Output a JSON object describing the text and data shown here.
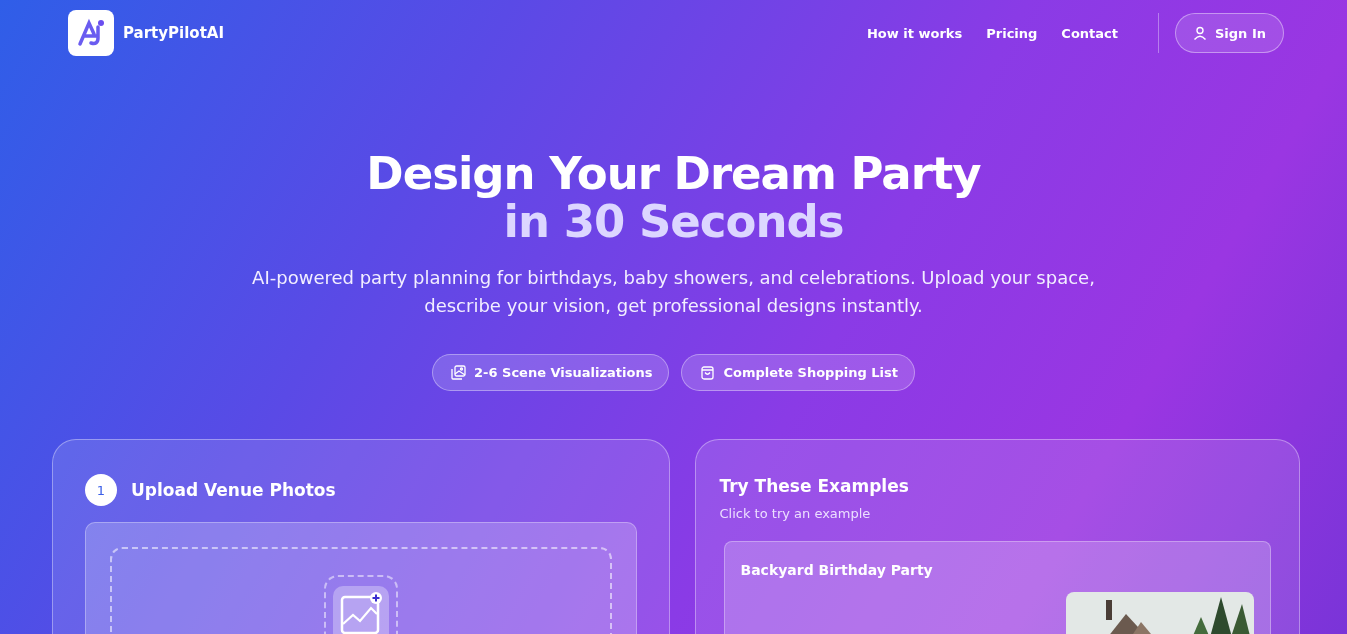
{
  "brand": {
    "name": "PartyPilotAI"
  },
  "nav": {
    "links": [
      "How it works",
      "Pricing",
      "Contact"
    ],
    "sign_in": "Sign In"
  },
  "hero": {
    "title_line_1": "Design Your Dream Party",
    "title_line_2": "in 30 Seconds",
    "subtitle": "AI-powered party planning for birthdays, baby showers, and celebrations. Upload your space, describe your vision, get professional designs instantly.",
    "features": [
      {
        "kind": "images",
        "label": "2-6 Scene Visualizations"
      },
      {
        "kind": "bag",
        "label": "Complete Shopping List"
      }
    ]
  },
  "upload": {
    "step": "1",
    "title": "Upload Venue Photos"
  },
  "examples": {
    "title": "Try These Examples",
    "subtitle": "Click to try an example",
    "items": [
      {
        "title": "Backyard Birthday Party",
        "kind": "picture"
      }
    ]
  }
}
